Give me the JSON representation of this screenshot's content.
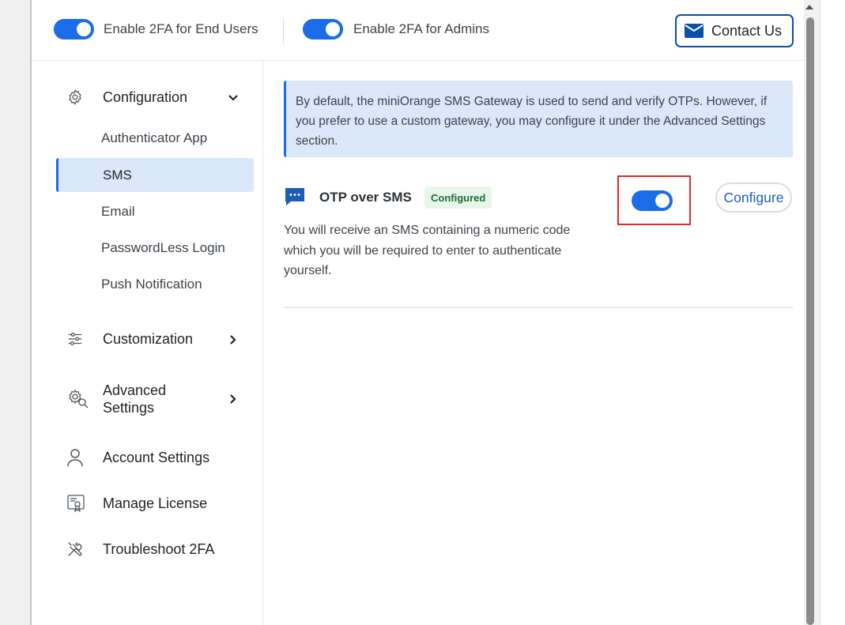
{
  "topbar": {
    "toggle_end_users": {
      "label": "Enable 2FA for End Users",
      "on": true
    },
    "toggle_admins": {
      "label": "Enable 2FA for Admins",
      "on": true
    },
    "contact_label": "Contact Us"
  },
  "sidebar": {
    "configuration": {
      "label": "Configuration",
      "icon": "gear-icon",
      "expanded": true,
      "items": [
        {
          "label": "Authenticator App",
          "active": false
        },
        {
          "label": "SMS",
          "active": true
        },
        {
          "label": "Email",
          "active": false
        },
        {
          "label": "PasswordLess Login",
          "active": false
        },
        {
          "label": "Push Notification",
          "active": false
        }
      ]
    },
    "customization": {
      "label": "Customization",
      "icon": "sliders-icon"
    },
    "advanced_settings": {
      "label_line1": "Advanced",
      "label_line2": "Settings",
      "icon": "gear-search-icon"
    },
    "account_settings": {
      "label": "Account Settings",
      "icon": "user-icon"
    },
    "manage_license": {
      "label": "Manage License",
      "icon": "certificate-icon"
    },
    "troubleshoot": {
      "label": "Troubleshoot 2FA",
      "icon": "tools-icon"
    }
  },
  "main": {
    "notice": "By default, the miniOrange SMS Gateway is used to send and verify OTPs. However, if you prefer to use a custom gateway, you may configure it under the Advanced Settings section.",
    "method": {
      "title": "OTP over SMS",
      "badge": "Configured",
      "description": "You will receive an SMS containing a numeric code which you will be required to enter to authenticate yourself.",
      "enabled": true,
      "configure_label": "Configure"
    }
  },
  "colors": {
    "accent": "#1a6ce8",
    "highlight_box": "#e0282b",
    "badge_bg": "#e6f7ea",
    "badge_text": "#1e6b36",
    "notice_bg": "#dbe8f9"
  }
}
